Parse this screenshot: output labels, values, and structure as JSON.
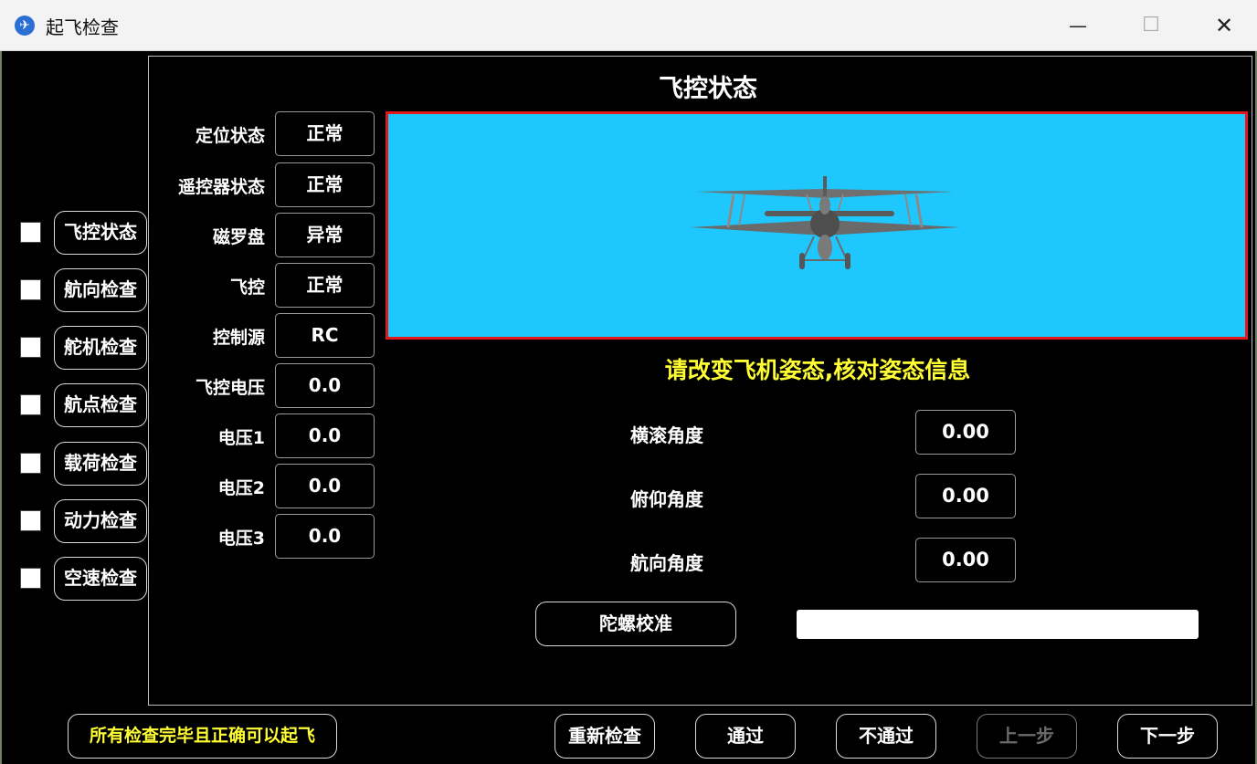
{
  "window": {
    "title": "起飞检查",
    "icon": "app-plane-icon"
  },
  "panel": {
    "title": "飞控状态"
  },
  "steps": [
    {
      "label": "飞控状态",
      "checked": false
    },
    {
      "label": "航向检查",
      "checked": false
    },
    {
      "label": "舵机检查",
      "checked": false
    },
    {
      "label": "航点检查",
      "checked": false
    },
    {
      "label": "载荷检查",
      "checked": false
    },
    {
      "label": "动力检查",
      "checked": false
    },
    {
      "label": "空速检查",
      "checked": false
    }
  ],
  "status": [
    {
      "label": "定位状态",
      "value": "正常"
    },
    {
      "label": "遥控器状态",
      "value": "正常"
    },
    {
      "label": "磁罗盘",
      "value": "异常"
    },
    {
      "label": "飞控",
      "value": "正常"
    },
    {
      "label": "控制源",
      "value": "RC"
    },
    {
      "label": "飞控电压",
      "value": "0.0"
    },
    {
      "label": "电压1",
      "value": "0.0"
    },
    {
      "label": "电压2",
      "value": "0.0"
    },
    {
      "label": "电压3",
      "value": "0.0"
    }
  ],
  "attitude_view": {
    "sky_color": "#1ec8fe",
    "border_color": "#e01a1a"
  },
  "hint": "请改变飞机姿态,核对姿态信息",
  "angles": [
    {
      "label": "横滚角度",
      "value": "0.00"
    },
    {
      "label": "俯仰角度",
      "value": "0.00"
    },
    {
      "label": "航向角度",
      "value": "0.00"
    }
  ],
  "gyro": {
    "button_label": "陀螺校准",
    "progress": 0
  },
  "footer": {
    "notice": "所有检查完毕且正确可以起飞",
    "buttons": {
      "recheck": "重新检查",
      "pass": "通过",
      "fail": "不通过",
      "prev": "上一步",
      "next": "下一步"
    }
  },
  "colors": {
    "accent_yellow": "#ffff33",
    "background": "#000000"
  }
}
